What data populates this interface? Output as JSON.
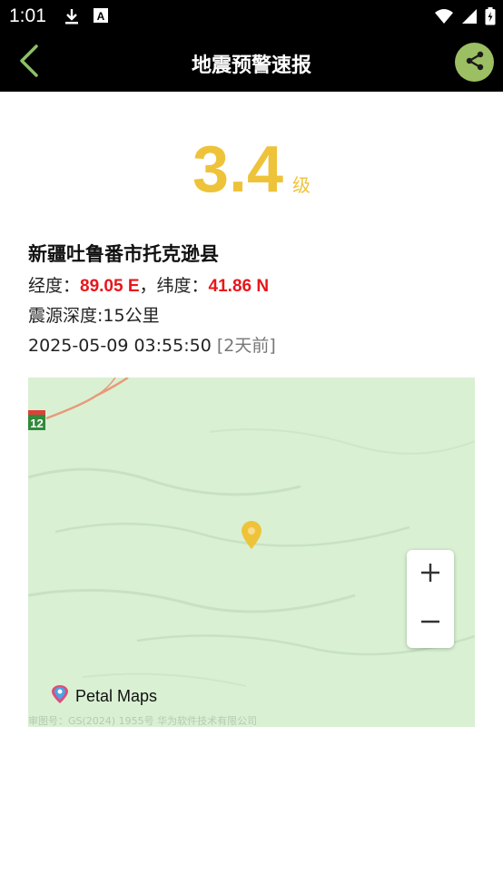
{
  "status": {
    "time": "1:01",
    "icons_left": [
      "download-icon",
      "font-icon"
    ],
    "icons_right": [
      "wifi-icon",
      "signal-icon",
      "battery-icon"
    ]
  },
  "appbar": {
    "title": "地震预警速报",
    "back_icon": "chevron-left-icon",
    "share_icon": "share-icon",
    "accent": "#9bbf62"
  },
  "quake": {
    "magnitude": "3.4",
    "unit": "级",
    "location": "新疆吐鲁番市托克逊县",
    "lon_label": "经度：",
    "lon_value": "89.05 E",
    "lat_label": "，纬度：",
    "lat_value": "41.86 N",
    "depth": "震源深度:15公里",
    "datetime": "2025-05-09 03:55:50",
    "ago": "[2天前]",
    "mag_color": "#eec33a",
    "coord_color": "#e8161b"
  },
  "map": {
    "brand": "Petal Maps",
    "license": "审图号：GS(2024) 1955号 华为软件技术有限公司",
    "route_number": "12",
    "zoom_in_icon": "plus-icon",
    "zoom_out_icon": "minus-icon",
    "pin_icon": "location-pin-icon",
    "background": "#d9f0d3"
  }
}
